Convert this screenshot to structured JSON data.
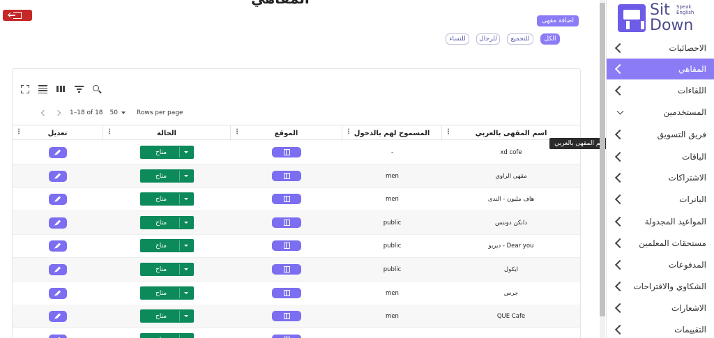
{
  "header": {
    "title": "المقاهي",
    "add_button": "اضافة مقهى"
  },
  "filters": [
    "الكل",
    "للتجميع",
    "للرجال",
    "للنساء"
  ],
  "brand": {
    "line1": "Sit",
    "line2": "Down",
    "tagline1": "Speak",
    "tagline2": "English"
  },
  "sidebar": {
    "items": [
      {
        "label": "الاحصائيات"
      },
      {
        "label": "المقاهي"
      },
      {
        "label": "اللقاءات"
      },
      {
        "label": "المستخدمين"
      },
      {
        "label": "فريق التسويق"
      },
      {
        "label": "الباقات"
      },
      {
        "label": "الاشتراكات"
      },
      {
        "label": "البانرات"
      },
      {
        "label": "المواعيد المجدولة"
      },
      {
        "label": "مستحقات المعلمين"
      },
      {
        "label": "المدفوعات"
      },
      {
        "label": "الشكاوي والاقتراحات"
      },
      {
        "label": "الاشعارات"
      },
      {
        "label": "التقييمات"
      }
    ]
  },
  "pagination": {
    "range": "1–18 of 18",
    "page_size": "50",
    "rows_per_page_label": "Rows per page"
  },
  "table": {
    "columns": {
      "name_ar": "اسم المقهى بالعربي",
      "allowed": "المسموح لهم بالدخول",
      "location": "الموقع",
      "status": "الحالة",
      "edit": "تعديل"
    },
    "rows": [
      {
        "name": "xd cofe",
        "allowed": "-",
        "status": "متاح"
      },
      {
        "name": "مقهى الراوي",
        "allowed": "men",
        "status": "متاح"
      },
      {
        "name": "هاف مليون - الندى",
        "allowed": "men",
        "status": "متاح"
      },
      {
        "name": "دانكن دونتس",
        "allowed": "public",
        "status": "متاح"
      },
      {
        "name": "ديربو - Dear you",
        "allowed": "public",
        "status": "متاح"
      },
      {
        "name": "ايكول",
        "allowed": "public",
        "status": "متاح"
      },
      {
        "name": "جرس",
        "allowed": "men",
        "status": "متاح"
      },
      {
        "name": "QUE Cafe",
        "allowed": "men",
        "status": "متاح"
      }
    ]
  },
  "tooltip": "اسم المقهى بالعربي",
  "colors": {
    "accent": "#8b7cf6",
    "status_green": "#0d8a5a",
    "logout_red": "#c62828"
  }
}
